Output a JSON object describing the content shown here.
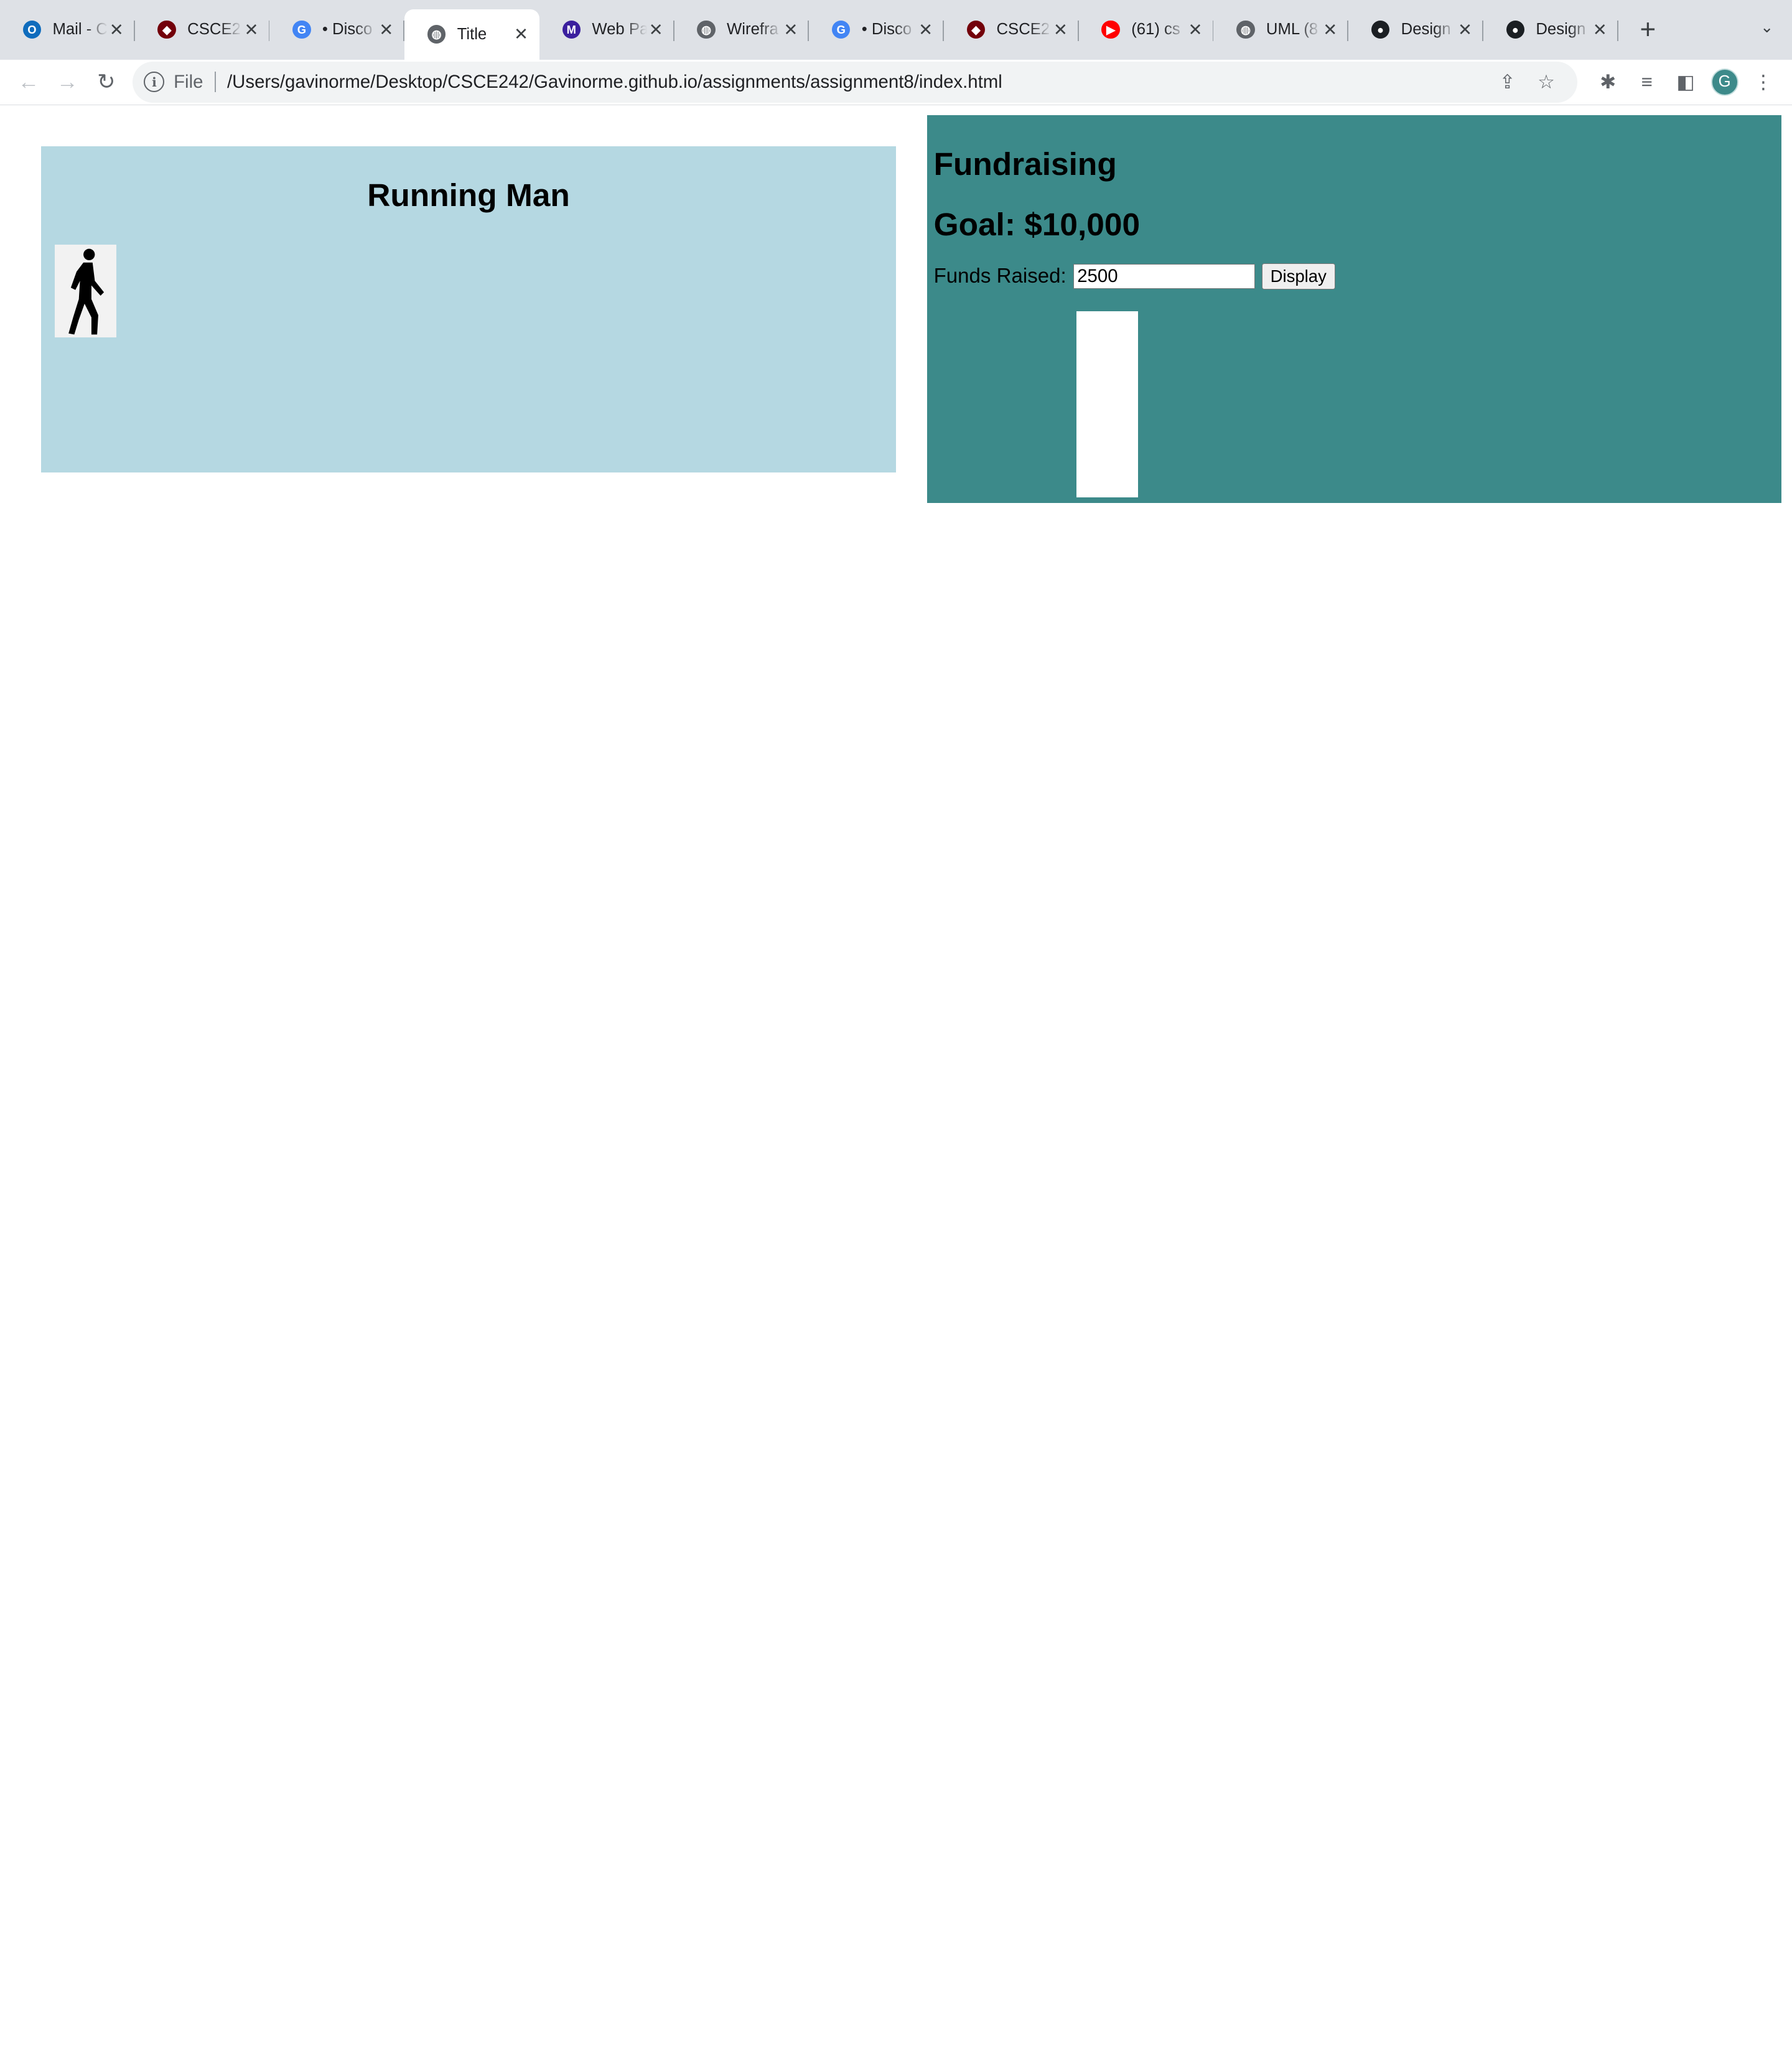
{
  "browser": {
    "tabs": [
      {
        "title": "Mail - C",
        "icon": "outlook-icon",
        "color": "#0f6cbd",
        "active": false
      },
      {
        "title": "CSCE2",
        "icon": "gamecock-icon",
        "color": "#73000a",
        "active": false
      },
      {
        "title": "• Disco",
        "icon": "google-circle-icon",
        "color": "#4285f4",
        "active": false
      },
      {
        "title": "Title",
        "icon": "globe-icon",
        "color": "#5f6368",
        "active": true
      },
      {
        "title": "Web Pa",
        "icon": "m-icon",
        "color": "#3b1f9e",
        "active": false
      },
      {
        "title": "Wirefra",
        "icon": "globe-icon",
        "color": "#5f6368",
        "active": false
      },
      {
        "title": "• Disco",
        "icon": "google-circle-icon",
        "color": "#4285f4",
        "active": false
      },
      {
        "title": "CSCE2",
        "icon": "gamecock-icon",
        "color": "#73000a",
        "active": false
      },
      {
        "title": "(61) cs",
        "icon": "youtube-icon",
        "color": "#ff0000",
        "active": false
      },
      {
        "title": "UML (8",
        "icon": "globe-icon",
        "color": "#5f6368",
        "active": false
      },
      {
        "title": "Design",
        "icon": "github-icon",
        "color": "#1b1f23",
        "active": false
      },
      {
        "title": "Design",
        "icon": "github-icon",
        "color": "#1b1f23",
        "active": false
      }
    ],
    "omnibox": {
      "scheme": "File",
      "url": "/Users/gavinorme/Desktop/CSCE242/Gavinorme.github.io/assignments/assignment8/index.html"
    },
    "profile_initial": "G"
  },
  "running": {
    "title": "Running Man",
    "figure_icon": "walking-person-icon"
  },
  "fundraising": {
    "title": "Fundraising",
    "goal": "Goal: $10,000",
    "funds_label": "Funds Raised:",
    "funds_value": "2500",
    "display_button": "Display",
    "progress_fraction": 0.25,
    "thermometer_color": "#ffffff",
    "panel_color": "#3c8a8a"
  }
}
